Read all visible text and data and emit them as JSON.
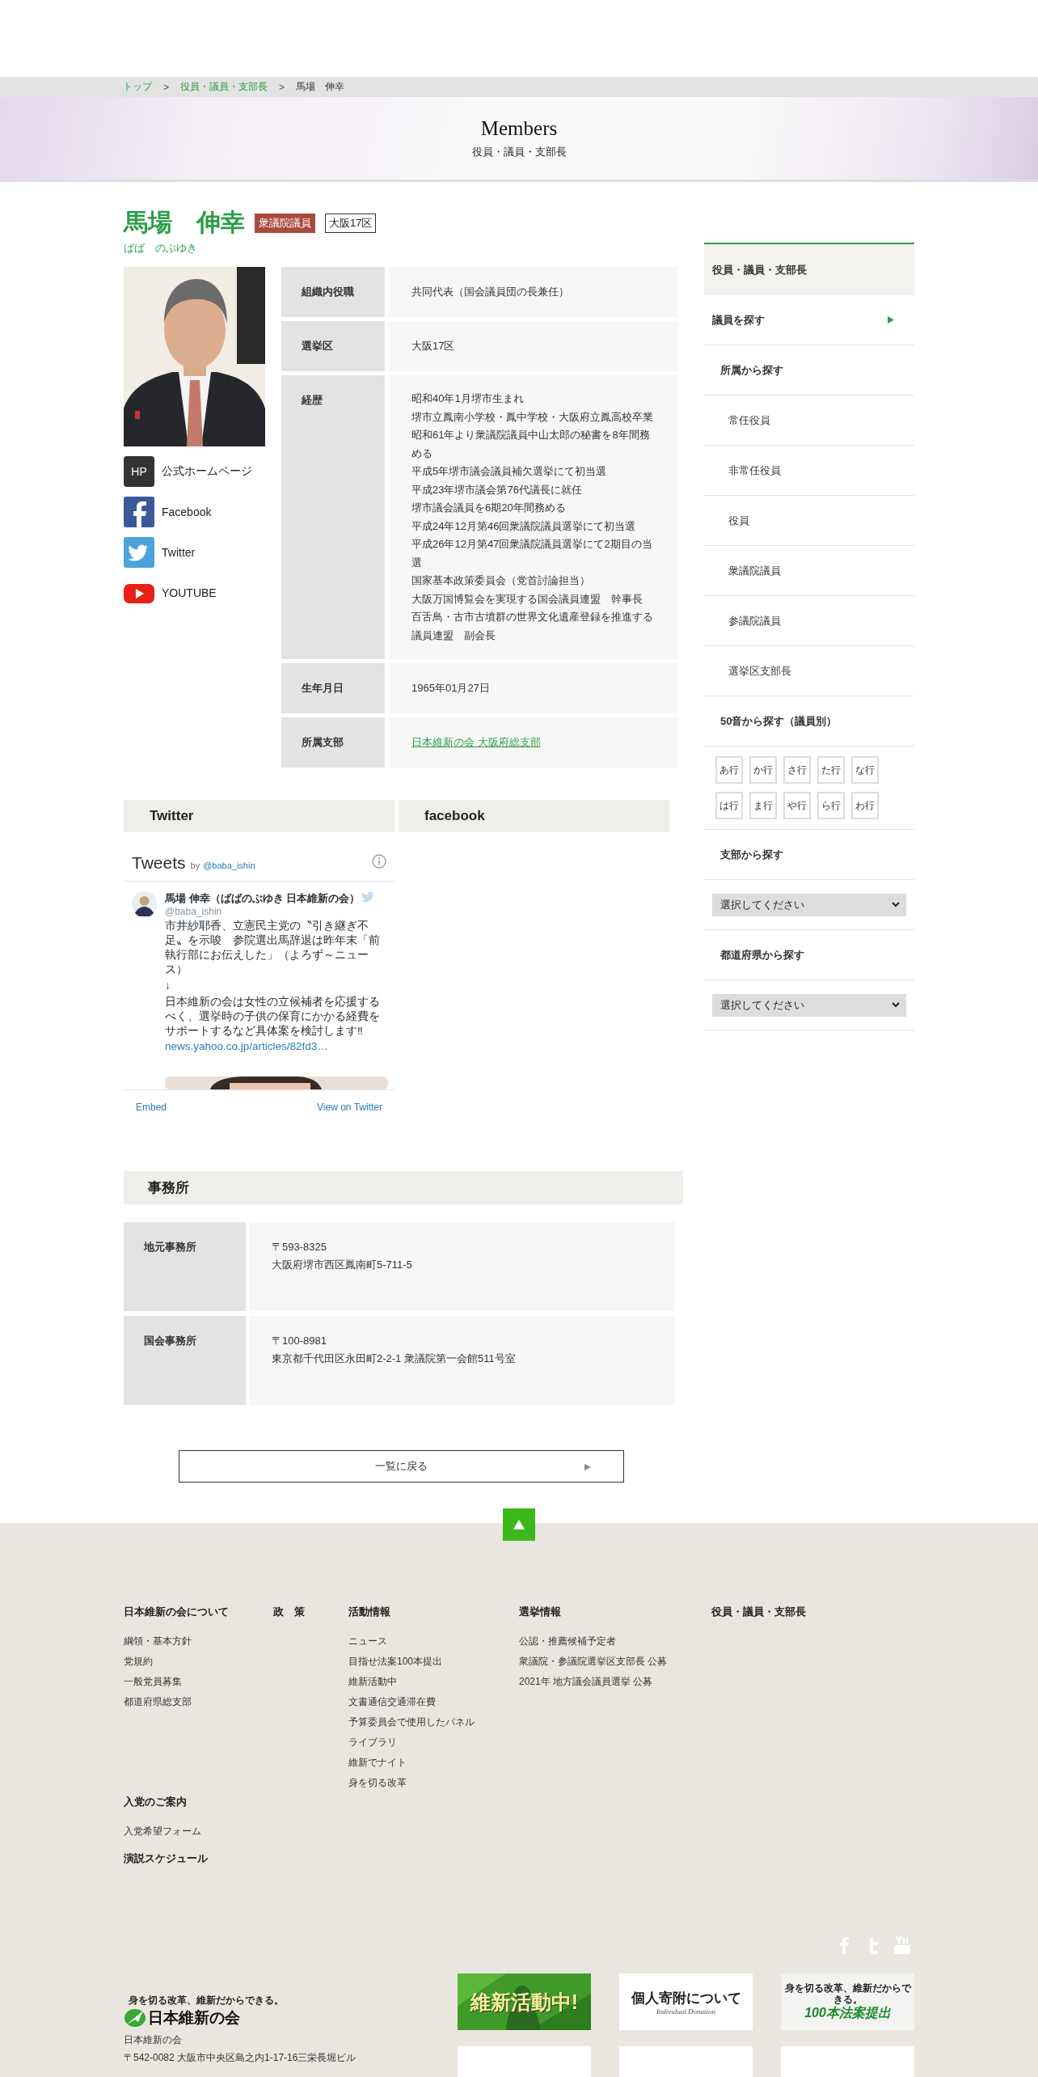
{
  "breadcrumb": [
    {
      "label": "トップ",
      "link": true
    },
    {
      "separator": ">",
      "label": "役員・議員・支部長",
      "link": true
    },
    {
      "separator": ">",
      "label": "馬場　伸幸",
      "link": false
    }
  ],
  "banner": {
    "title": "Members",
    "subtitle": "役員・議員・支部長"
  },
  "profile": {
    "name": "馬場　伸幸",
    "kana": "ばば　のぶゆき",
    "badges": [
      {
        "label": "衆議院議員",
        "kind": "filled"
      },
      {
        "label": "大阪17区",
        "kind": "outline"
      }
    ],
    "links": [
      {
        "kind": "hp",
        "icon_text": "HP",
        "label": "公式ホームページ"
      },
      {
        "kind": "facebook",
        "label": "Facebook"
      },
      {
        "kind": "twitter",
        "label": "Twitter"
      },
      {
        "kind": "youtube",
        "label": "YOUTUBE"
      }
    ],
    "details": [
      {
        "label": "組織内役職",
        "lines": [
          "共同代表（国会議員団の長兼任）"
        ],
        "link": false
      },
      {
        "label": "選挙区",
        "lines": [
          "大阪17区"
        ],
        "link": false
      },
      {
        "label": "経歴",
        "lines": [
          "昭和40年1月堺市生まれ",
          "堺市立鳳南小学校・鳳中学校・大阪府立鳳高校卒業",
          "昭和61年より衆議院議員中山太郎の秘書を8年間務める",
          "平成5年堺市議会議員補欠選挙にて初当選",
          "平成23年堺市議会第76代議長に就任",
          "堺市議会議員を6期20年間務める",
          "平成24年12月第46回衆議院議員選挙にて初当選",
          "平成26年12月第47回衆議院議員選挙にて2期目の当選",
          "国家基本政策委員会（党首討論担当）",
          "大阪万国博覧会を実現する国会議員連盟　幹事長",
          "百舌鳥・古市古墳群の世界文化遺産登録を推進する議員連盟　副会長"
        ],
        "link": false
      },
      {
        "label": "生年月日",
        "lines": [
          "1965年01月27日"
        ],
        "link": false
      },
      {
        "label": "所属支部",
        "lines": [
          "日本維新の会 大阪府総支部"
        ],
        "link": true
      }
    ]
  },
  "social": {
    "twitter_heading": "Twitter",
    "facebook_heading": "facebook",
    "widget": {
      "title": "Tweets",
      "by": "by",
      "handle": "@baba_ishin",
      "tweet": {
        "author": "馬場 伸幸（ばばのぶゆき 日本維新の会）",
        "handle": "@baba_ishin",
        "paragraphs": [
          "市井紗耶香、立憲民主党の〝引き継ぎ不足〟を示唆　参院選出馬辞退は昨年末「前執行部にお伝えした」（よろず～ニュース）",
          "↓",
          "日本維新の会は女性の立候補者を応援するべく、選挙時の子供の保育にかかる経費をサポートするなど具体案を検討します‼"
        ],
        "link": "news.yahoo.co.jp/articles/82fd3…"
      },
      "embed": "Embed",
      "view": "View on Twitter"
    }
  },
  "office": {
    "title": "事務所",
    "rows": [
      {
        "label": "地元事務所",
        "postal": "〒593-8325",
        "address": "大阪府堺市西区鳳南町5-711-5"
      },
      {
        "label": "国会事務所",
        "postal": "〒100-8981",
        "address": "東京都千代田区永田町2-2-1 衆議院第一会館511号室"
      }
    ]
  },
  "back_button": "一覧に戻る",
  "sidebar": {
    "title": "役員・議員・支部長",
    "items": [
      {
        "label": "議員を探す",
        "kind": "section"
      },
      {
        "label": "所属から探す",
        "kind": "heading"
      },
      {
        "label": "常任役員",
        "kind": "item"
      },
      {
        "label": "非常任役員",
        "kind": "item"
      },
      {
        "label": "役員",
        "kind": "item"
      },
      {
        "label": "衆議院議員",
        "kind": "item"
      },
      {
        "label": "参議院議員",
        "kind": "item"
      },
      {
        "label": "選挙区支部長",
        "kind": "item"
      },
      {
        "label": "50音から探す（議員別）",
        "kind": "heading"
      },
      {
        "kind": "kana",
        "keys": [
          "あ行",
          "か行",
          "さ行",
          "た行",
          "な行",
          "は行",
          "ま行",
          "や行",
          "ら行",
          "わ行"
        ]
      },
      {
        "label": "支部から探す",
        "kind": "heading"
      },
      {
        "kind": "select",
        "value": "選択してください"
      },
      {
        "label": "都道府県から探す",
        "kind": "heading"
      },
      {
        "kind": "select",
        "value": "選択してください"
      }
    ]
  },
  "footer": {
    "columns": [
      {
        "heading": "日本維新の会について",
        "links": [
          "綱領・基本方針",
          "党規約",
          "一般党員募集",
          "都道府県総支部"
        ]
      },
      {
        "heading": "政　策"
      },
      {
        "heading": "活動情報",
        "links": [
          "ニュース",
          "目指せ法案100本提出",
          "維新活動中",
          "文書通信交通滞在費",
          "予算委員会で使用したパネル",
          "ライブラリ",
          "維新でナイト",
          "身を切る改革"
        ]
      },
      {
        "heading": "選挙情報",
        "links": [
          "公認・推薦候補予定者",
          "衆議院・参議院選挙区支部長 公募",
          "2021年 地方議会議員選挙 公募"
        ]
      },
      {
        "heading": "役員・議員・支部長"
      }
    ],
    "extra": [
      {
        "heading": "入党のご案内",
        "links": [
          "入党希望フォーム"
        ]
      },
      {
        "heading": "演説スケジュール"
      }
    ],
    "social_icons": [
      {
        "kind": "facebook"
      },
      {
        "kind": "twitter"
      },
      {
        "kind": "youtube"
      }
    ],
    "logo": {
      "tagline": "身を切る改革、維新だからできる。",
      "name": "日本維新の会"
    },
    "org": {
      "name": "日本維新の会",
      "address": "〒542-0082 大阪市中央区島之内1-17-16三栄長堀ビル"
    },
    "banners": [
      {
        "kind": "activity",
        "title": "維新活動中!"
      },
      {
        "kind": "donation",
        "title": "個人寄附について",
        "subtitle": "Individual Donation"
      },
      {
        "kind": "bills",
        "tagline": "身を切る改革、維新だからできる。",
        "title": "100本法案提出"
      },
      {
        "kind": "blank"
      },
      {
        "kind": "blank"
      },
      {
        "kind": "blank"
      }
    ]
  }
}
